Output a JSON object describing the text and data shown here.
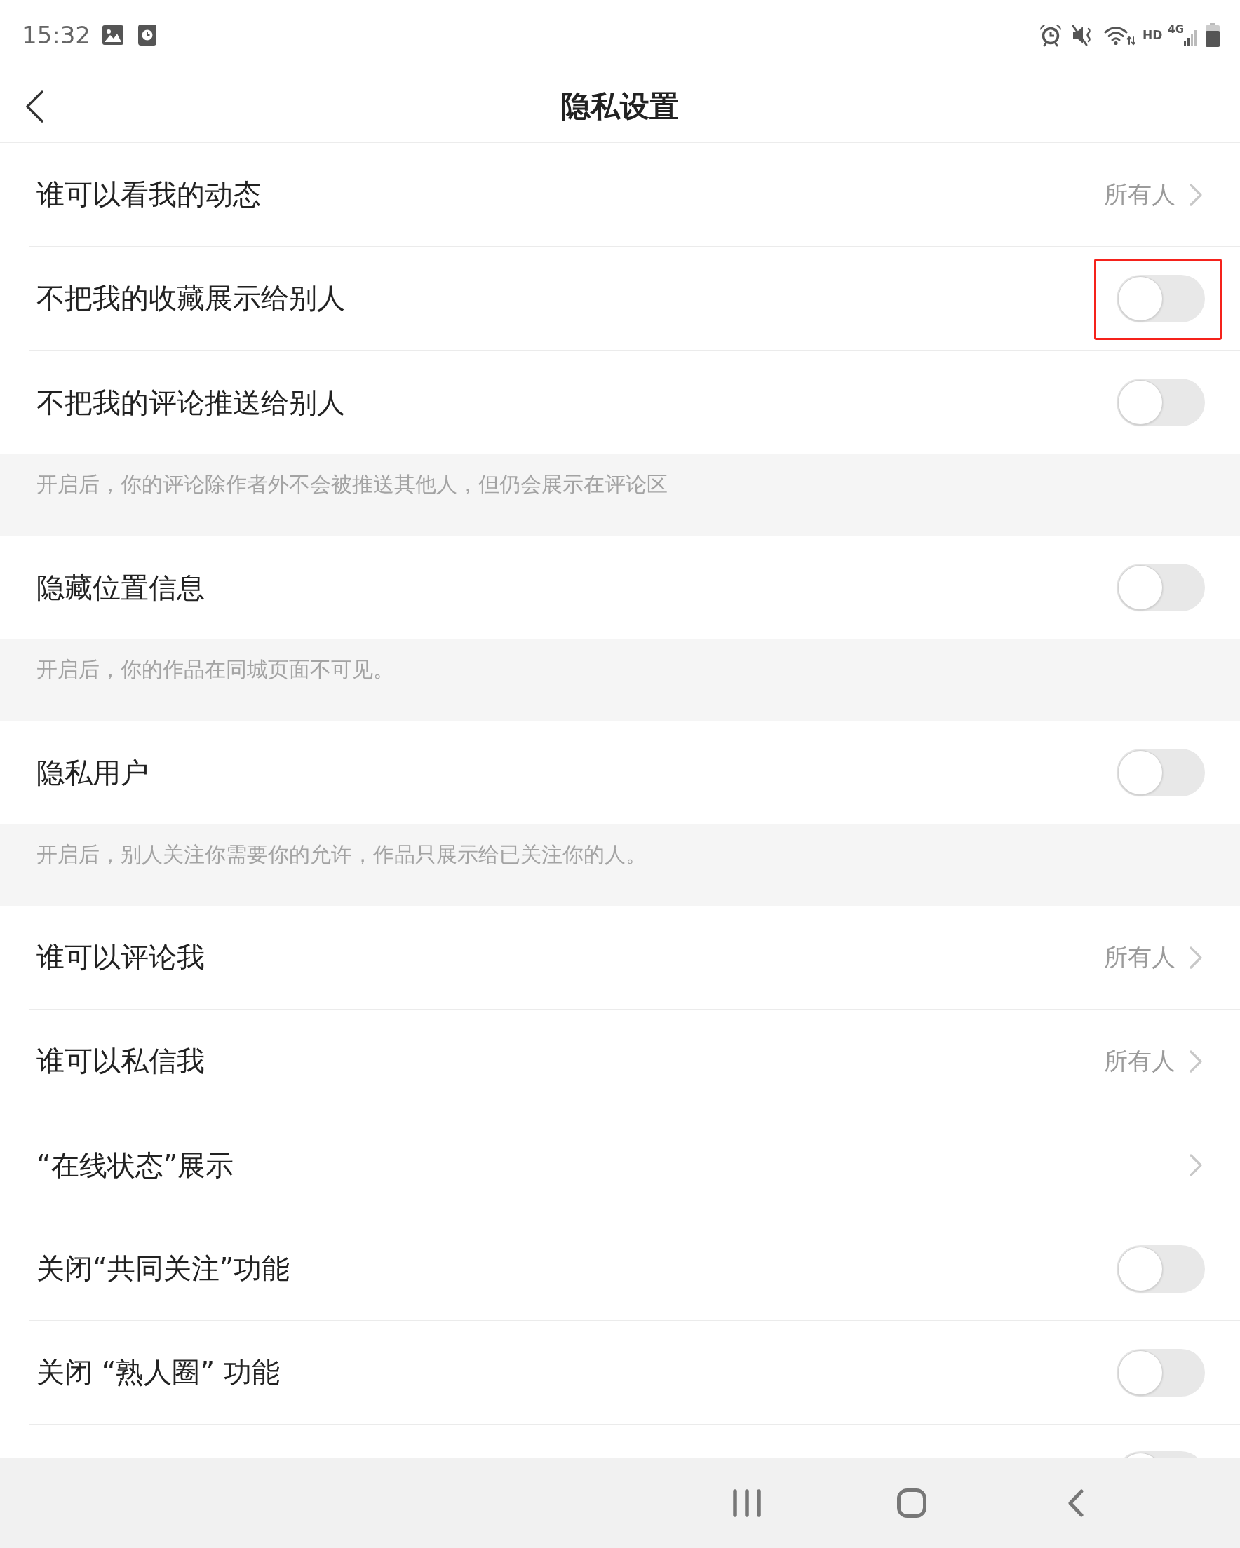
{
  "status_bar": {
    "time": "15:32",
    "hd": "HD",
    "network": "4G"
  },
  "header": {
    "title": "隐私设置"
  },
  "settings": [
    {
      "kind": "link",
      "label": "谁可以看我的动态",
      "value": "所有人",
      "divider": true,
      "highlighted": false
    },
    {
      "kind": "toggle",
      "label": "不把我的收藏展示给别人",
      "on": false,
      "divider": true,
      "highlighted": true
    },
    {
      "kind": "toggle",
      "label": "不把我的评论推送给别人",
      "on": false,
      "divider": false,
      "highlighted": false
    },
    {
      "kind": "note",
      "text": "开启后，你的评论除作者外不会被推送其他人，但仍会展示在评论区"
    },
    {
      "kind": "toggle",
      "label": "隐藏位置信息",
      "on": false,
      "divider": false,
      "highlighted": false
    },
    {
      "kind": "note",
      "text": "开启后，你的作品在同城页面不可见。"
    },
    {
      "kind": "toggle",
      "label": "隐私用户",
      "on": false,
      "divider": false,
      "highlighted": false
    },
    {
      "kind": "note",
      "text": "开启后，别人关注你需要你的允许，作品只展示给已关注你的人。"
    },
    {
      "kind": "link",
      "label": "谁可以评论我",
      "value": "所有人",
      "divider": true,
      "highlighted": false
    },
    {
      "kind": "link",
      "label": "谁可以私信我",
      "value": "所有人",
      "divider": true,
      "highlighted": false
    },
    {
      "kind": "link",
      "label": "“在线状态”展示",
      "divider": false,
      "highlighted": false
    },
    {
      "kind": "toggle",
      "label": "关闭“共同关注”功能",
      "on": false,
      "divider": true,
      "highlighted": false
    },
    {
      "kind": "toggle",
      "label": "关闭 “熟人圈” 功能",
      "on": false,
      "divider": true,
      "highlighted": false
    }
  ],
  "partial_row": {
    "kind": "toggle",
    "on": false
  }
}
